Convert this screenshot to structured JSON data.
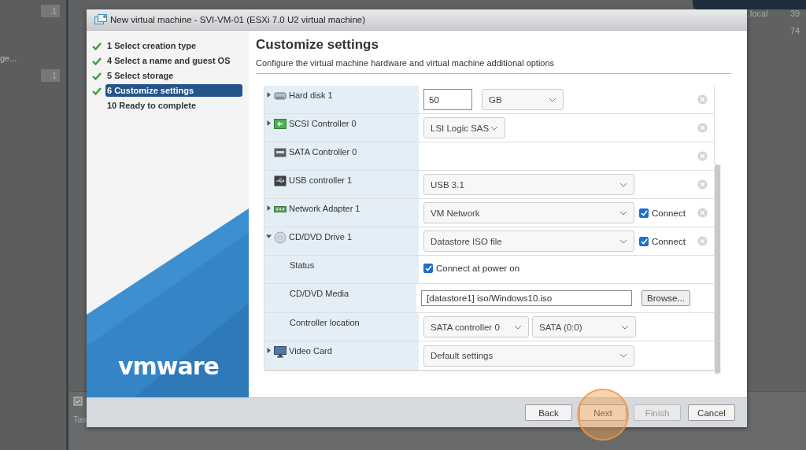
{
  "background": {
    "badges": [
      "1",
      "1"
    ],
    "nav_text": "ge...",
    "table_cells": [
      ".local",
      "39",
      "74"
    ],
    "tasks_label": "Tas"
  },
  "window": {
    "title": "New virtual machine - SVI-VM-01 (ESXi 7.0 U2 virtual machine)"
  },
  "steps": [
    {
      "label": "1 Select creation type",
      "done": true,
      "selected": false
    },
    {
      "label": "4 Select a name and guest OS",
      "done": true,
      "selected": false
    },
    {
      "label": "5 Select storage",
      "done": true,
      "selected": false
    },
    {
      "label": "6 Customize settings",
      "done": true,
      "selected": true
    },
    {
      "label": "10 Ready to complete",
      "done": false,
      "selected": false
    }
  ],
  "logo": "vmware",
  "heading": "Customize settings",
  "subtitle": "Configure the virtual machine hardware and virtual machine additional options",
  "devices": [
    {
      "label": "Hard disk 1",
      "kind": "disk",
      "expanded": false,
      "removable": true,
      "controls": [
        {
          "kind": "input",
          "value": "50"
        },
        {
          "kind": "select",
          "value": "GB"
        }
      ]
    },
    {
      "label": "SCSI Controller 0",
      "kind": "scsi",
      "expanded": false,
      "removable": true,
      "controls": [
        {
          "kind": "select",
          "value": "LSI Logic SAS"
        }
      ]
    },
    {
      "label": "SATA Controller 0",
      "kind": "sata",
      "removable": true
    },
    {
      "label": "USB controller 1",
      "kind": "usb",
      "removable": true,
      "controls": [
        {
          "kind": "select",
          "value": "USB 3.1"
        }
      ]
    },
    {
      "label": "Network Adapter 1",
      "kind": "network",
      "expanded": false,
      "removable": true,
      "controls": [
        {
          "kind": "select",
          "value": "VM Network"
        },
        {
          "kind": "checkbox",
          "label": "Connect",
          "checked": true
        }
      ]
    },
    {
      "label": "CD/DVD Drive 1",
      "kind": "disc",
      "expanded": true,
      "removable": true,
      "controls": [
        {
          "kind": "select",
          "value": "Datastore ISO file"
        },
        {
          "kind": "checkbox",
          "label": "Connect",
          "checked": true
        }
      ],
      "children": [
        {
          "label": "Status",
          "controls": [
            {
              "kind": "checkbox",
              "label": "Connect at power on",
              "checked": true
            }
          ]
        },
        {
          "label": "CD/DVD Media",
          "controls": [
            {
              "kind": "input",
              "value": "[datastore1] iso/Windows10.iso"
            },
            {
              "kind": "button",
              "label": "Browse..."
            }
          ]
        },
        {
          "label": "Controller location",
          "controls": [
            {
              "kind": "select",
              "value": "SATA controller 0"
            },
            {
              "kind": "select",
              "value": "SATA (0:0)"
            }
          ]
        }
      ]
    },
    {
      "label": "Video Card",
      "kind": "monitor",
      "expanded": false,
      "controls": [
        {
          "kind": "select",
          "value": "Default settings"
        }
      ]
    }
  ],
  "buttons": [
    {
      "label": "Back",
      "disabled": false,
      "highlighted": false
    },
    {
      "label": "Next",
      "disabled": false,
      "highlighted": true
    },
    {
      "label": "Finish",
      "disabled": true,
      "highlighted": false
    },
    {
      "label": "Cancel",
      "disabled": false,
      "highlighted": false
    }
  ]
}
